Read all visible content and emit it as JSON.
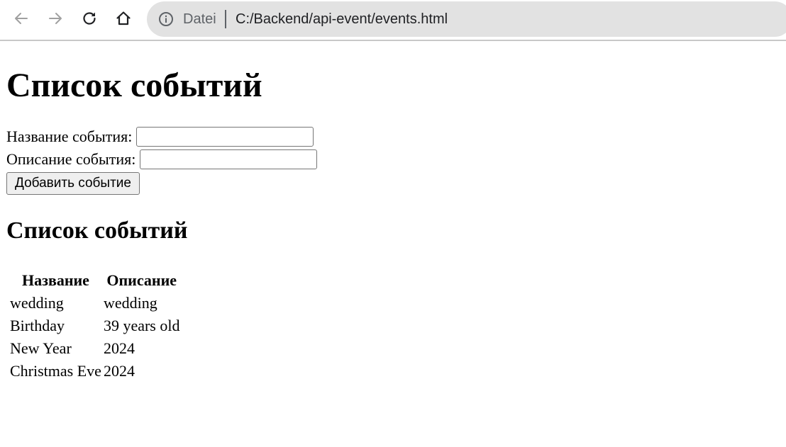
{
  "browser": {
    "icons": {
      "back": "arrow-left-icon",
      "forward": "arrow-right-icon",
      "reload": "reload-icon",
      "home": "home-icon",
      "info": "info-icon"
    },
    "address_bar": {
      "scheme_label": "Datei",
      "url": "C:/Backend/api-event/events.html"
    }
  },
  "page": {
    "title": "Список событий",
    "form": {
      "name_label": "Название события:",
      "name_value": "",
      "description_label": "Описание события:",
      "description_value": "",
      "submit_label": "Добавить событие"
    },
    "list_title": "Список событий",
    "table": {
      "headers": [
        "Название",
        "Описание"
      ],
      "rows": [
        [
          "wedding",
          "wedding"
        ],
        [
          "Birthday",
          "39 years old"
        ],
        [
          "New Year",
          "2024"
        ],
        [
          "Christmas Eve",
          "2024"
        ]
      ]
    }
  }
}
